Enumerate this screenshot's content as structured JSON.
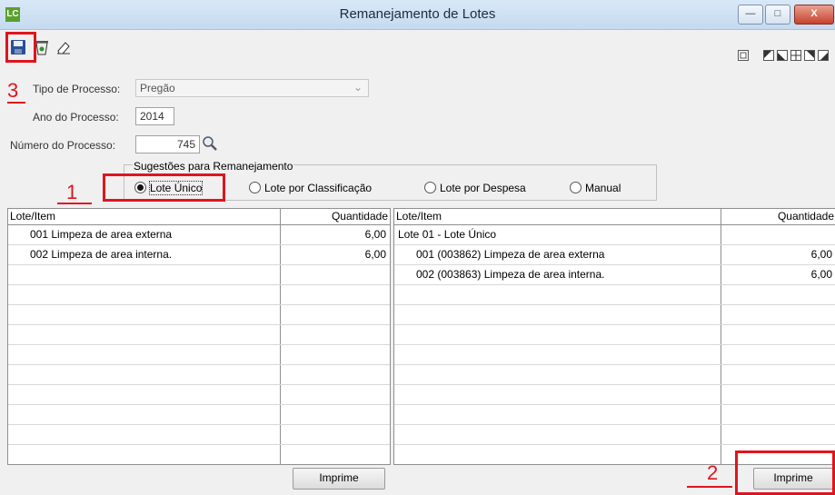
{
  "window": {
    "app_icon_text": "LC",
    "title": "Remanejamento de Lotes",
    "minimize": "—",
    "maximize": "□",
    "close": "X"
  },
  "annotations": {
    "n1": "1",
    "n2": "2",
    "n3": "3"
  },
  "form": {
    "tipo_label": "Tipo de Processo:",
    "tipo_value": "Pregão",
    "ano_label": "Ano do Processo:",
    "ano_value": "2014",
    "numero_label": "Número do Processo:",
    "numero_value": "745"
  },
  "suggestions": {
    "title": "Sugestões para Remanejamento",
    "options": [
      "Lote Único",
      "Lote por Classificação",
      "Lote por Despesa",
      "Manual"
    ],
    "selected": "Lote Único"
  },
  "left_grid": {
    "col_item": "Lote/Item",
    "col_qty": "Quantidade",
    "rows": [
      {
        "item": "001 Limpeza de area externa",
        "qty": "6,00"
      },
      {
        "item": "002 Limpeza de area interna.",
        "qty": "6,00"
      }
    ],
    "button": "Imprime"
  },
  "right_grid": {
    "col_item": "Lote/Item",
    "col_qty": "Quantidade",
    "rows": [
      {
        "item": "Lote 01 - Lote Único",
        "qty": ""
      },
      {
        "item": "001 (003862) Limpeza de area externa",
        "qty": "6,00"
      },
      {
        "item": "002 (003863) Limpeza de area interna.",
        "qty": "6,00"
      }
    ],
    "button": "Imprime"
  }
}
